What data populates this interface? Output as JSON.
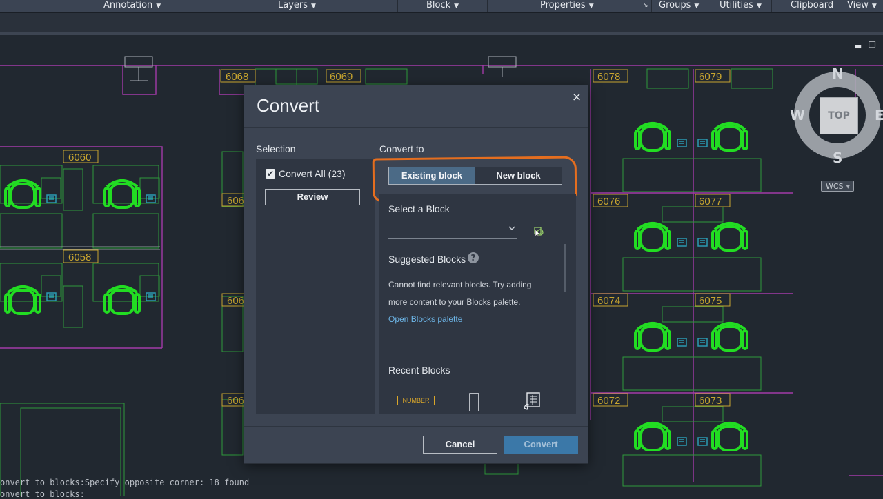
{
  "ribbon": {
    "panels": [
      {
        "label": "Annotation"
      },
      {
        "label": "Layers"
      },
      {
        "label": "Block"
      },
      {
        "label": "Properties"
      },
      {
        "label": "Groups"
      },
      {
        "label": "Utilities"
      },
      {
        "label": "Clipboard"
      },
      {
        "label": "View"
      }
    ]
  },
  "drawing": {
    "room_numbers": [
      "6068",
      "6069",
      "6078",
      "6079",
      "6060",
      "6058",
      "6076",
      "6077",
      "6074",
      "6075",
      "6072",
      "6073",
      "606",
      "606",
      "606"
    ]
  },
  "viewcube": {
    "north": "N",
    "south": "S",
    "west": "W",
    "east": "E",
    "face": "TOP",
    "ucs_label": "WCS"
  },
  "command_line": {
    "line1": "onvert to blocks:Specify opposite corner: 18 found",
    "line2": "onvert to blocks:"
  },
  "dialog": {
    "title": "Convert",
    "close_glyph": "×",
    "selection_label": "Selection",
    "convert_all_label": "Convert All (23)",
    "convert_all_checked": true,
    "check_glyph": "✔",
    "review_label": "Review",
    "convert_to_label": "Convert to",
    "existing_block_label": "Existing block",
    "new_block_label": "New block",
    "select_block_label": "Select a Block",
    "select_block_value": "",
    "caret_glyph": "⌄",
    "suggested_label": "Suggested Blocks",
    "help_glyph": "?",
    "cannot_find_line1": "Cannot find relevant blocks. Try adding",
    "cannot_find_line2": "more content to your Blocks palette.",
    "open_palette_label": "Open Blocks palette",
    "recent_label": "Recent Blocks",
    "recent_block_number_label": "NUMBER",
    "cancel_label": "Cancel",
    "convert_label": "Convert"
  },
  "colors": {
    "accent_orange": "#e56e1f",
    "segment_selected": "#4b6a86",
    "convert_button": "#3b78a8",
    "link": "#6db6e8",
    "chair_green": "#22dd22",
    "room_tag": "#c8a52f",
    "wall_magenta": "#a23aa8"
  }
}
